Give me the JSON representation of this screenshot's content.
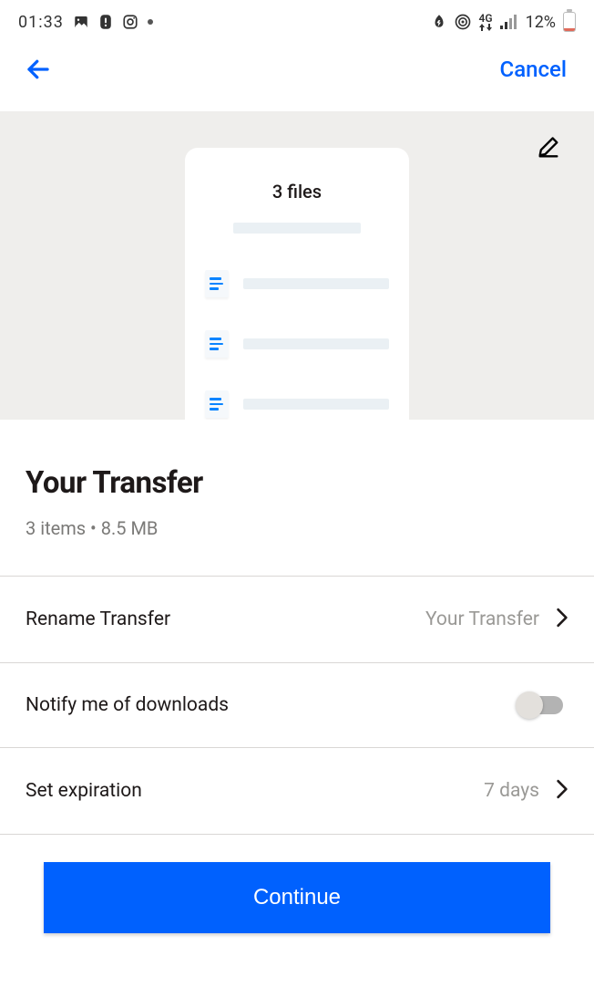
{
  "status": {
    "time": "01:33",
    "network_label": "4G",
    "battery_percent": "12%"
  },
  "header": {
    "cancel": "Cancel"
  },
  "preview": {
    "card_title": "3 files"
  },
  "main": {
    "title": "Your Transfer",
    "subtitle": "3 items • 8.5 MB"
  },
  "settings": {
    "rename": {
      "label": "Rename Transfer",
      "value": "Your Transfer"
    },
    "notify": {
      "label": "Notify me of downloads",
      "on": false
    },
    "expiration": {
      "label": "Set expiration",
      "value": "7 days"
    }
  },
  "footer": {
    "continue": "Continue"
  }
}
